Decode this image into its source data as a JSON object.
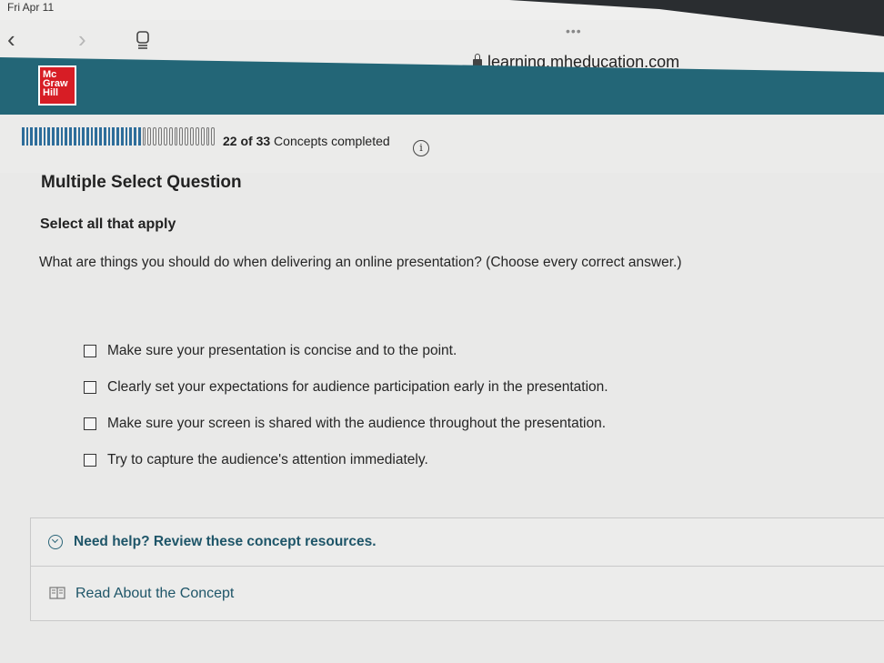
{
  "status_bar": {
    "date": "Fri Apr 11"
  },
  "browser": {
    "url": "learning.mheducation.com",
    "tab_dots": "•••"
  },
  "logo": {
    "line1": "Mc",
    "line2": "Graw",
    "line3": "Hill"
  },
  "progress": {
    "completed": "22",
    "of_label": "of",
    "total": "33",
    "label": "Concepts completed",
    "fraction": 0.667,
    "info_glyph": "i"
  },
  "question": {
    "type_label": "Multiple Select Question",
    "instruction": "Select all that apply",
    "prompt": "What are things you should do when delivering an online presentation? (Choose every correct answer.)",
    "options": [
      "Make sure your presentation is concise and to the point.",
      "Clearly set your expectations for audience participation early in the presentation.",
      "Make sure your screen is shared with the audience throughout the presentation.",
      "Try to capture the audience's attention immediately."
    ]
  },
  "help": {
    "title": "Need help? Review these concept resources.",
    "read_link": "Read About the Concept"
  },
  "colors": {
    "header_teal": "#236677",
    "brand_red": "#d71d25",
    "progress_fill": "#2d6d9a",
    "link_teal": "#1e5568"
  },
  "icons": [
    "back-chevron-icon",
    "forward-chevron-icon",
    "tabs-icon",
    "lock-icon",
    "info-icon",
    "chevron-down-circle-icon",
    "book-icon"
  ]
}
